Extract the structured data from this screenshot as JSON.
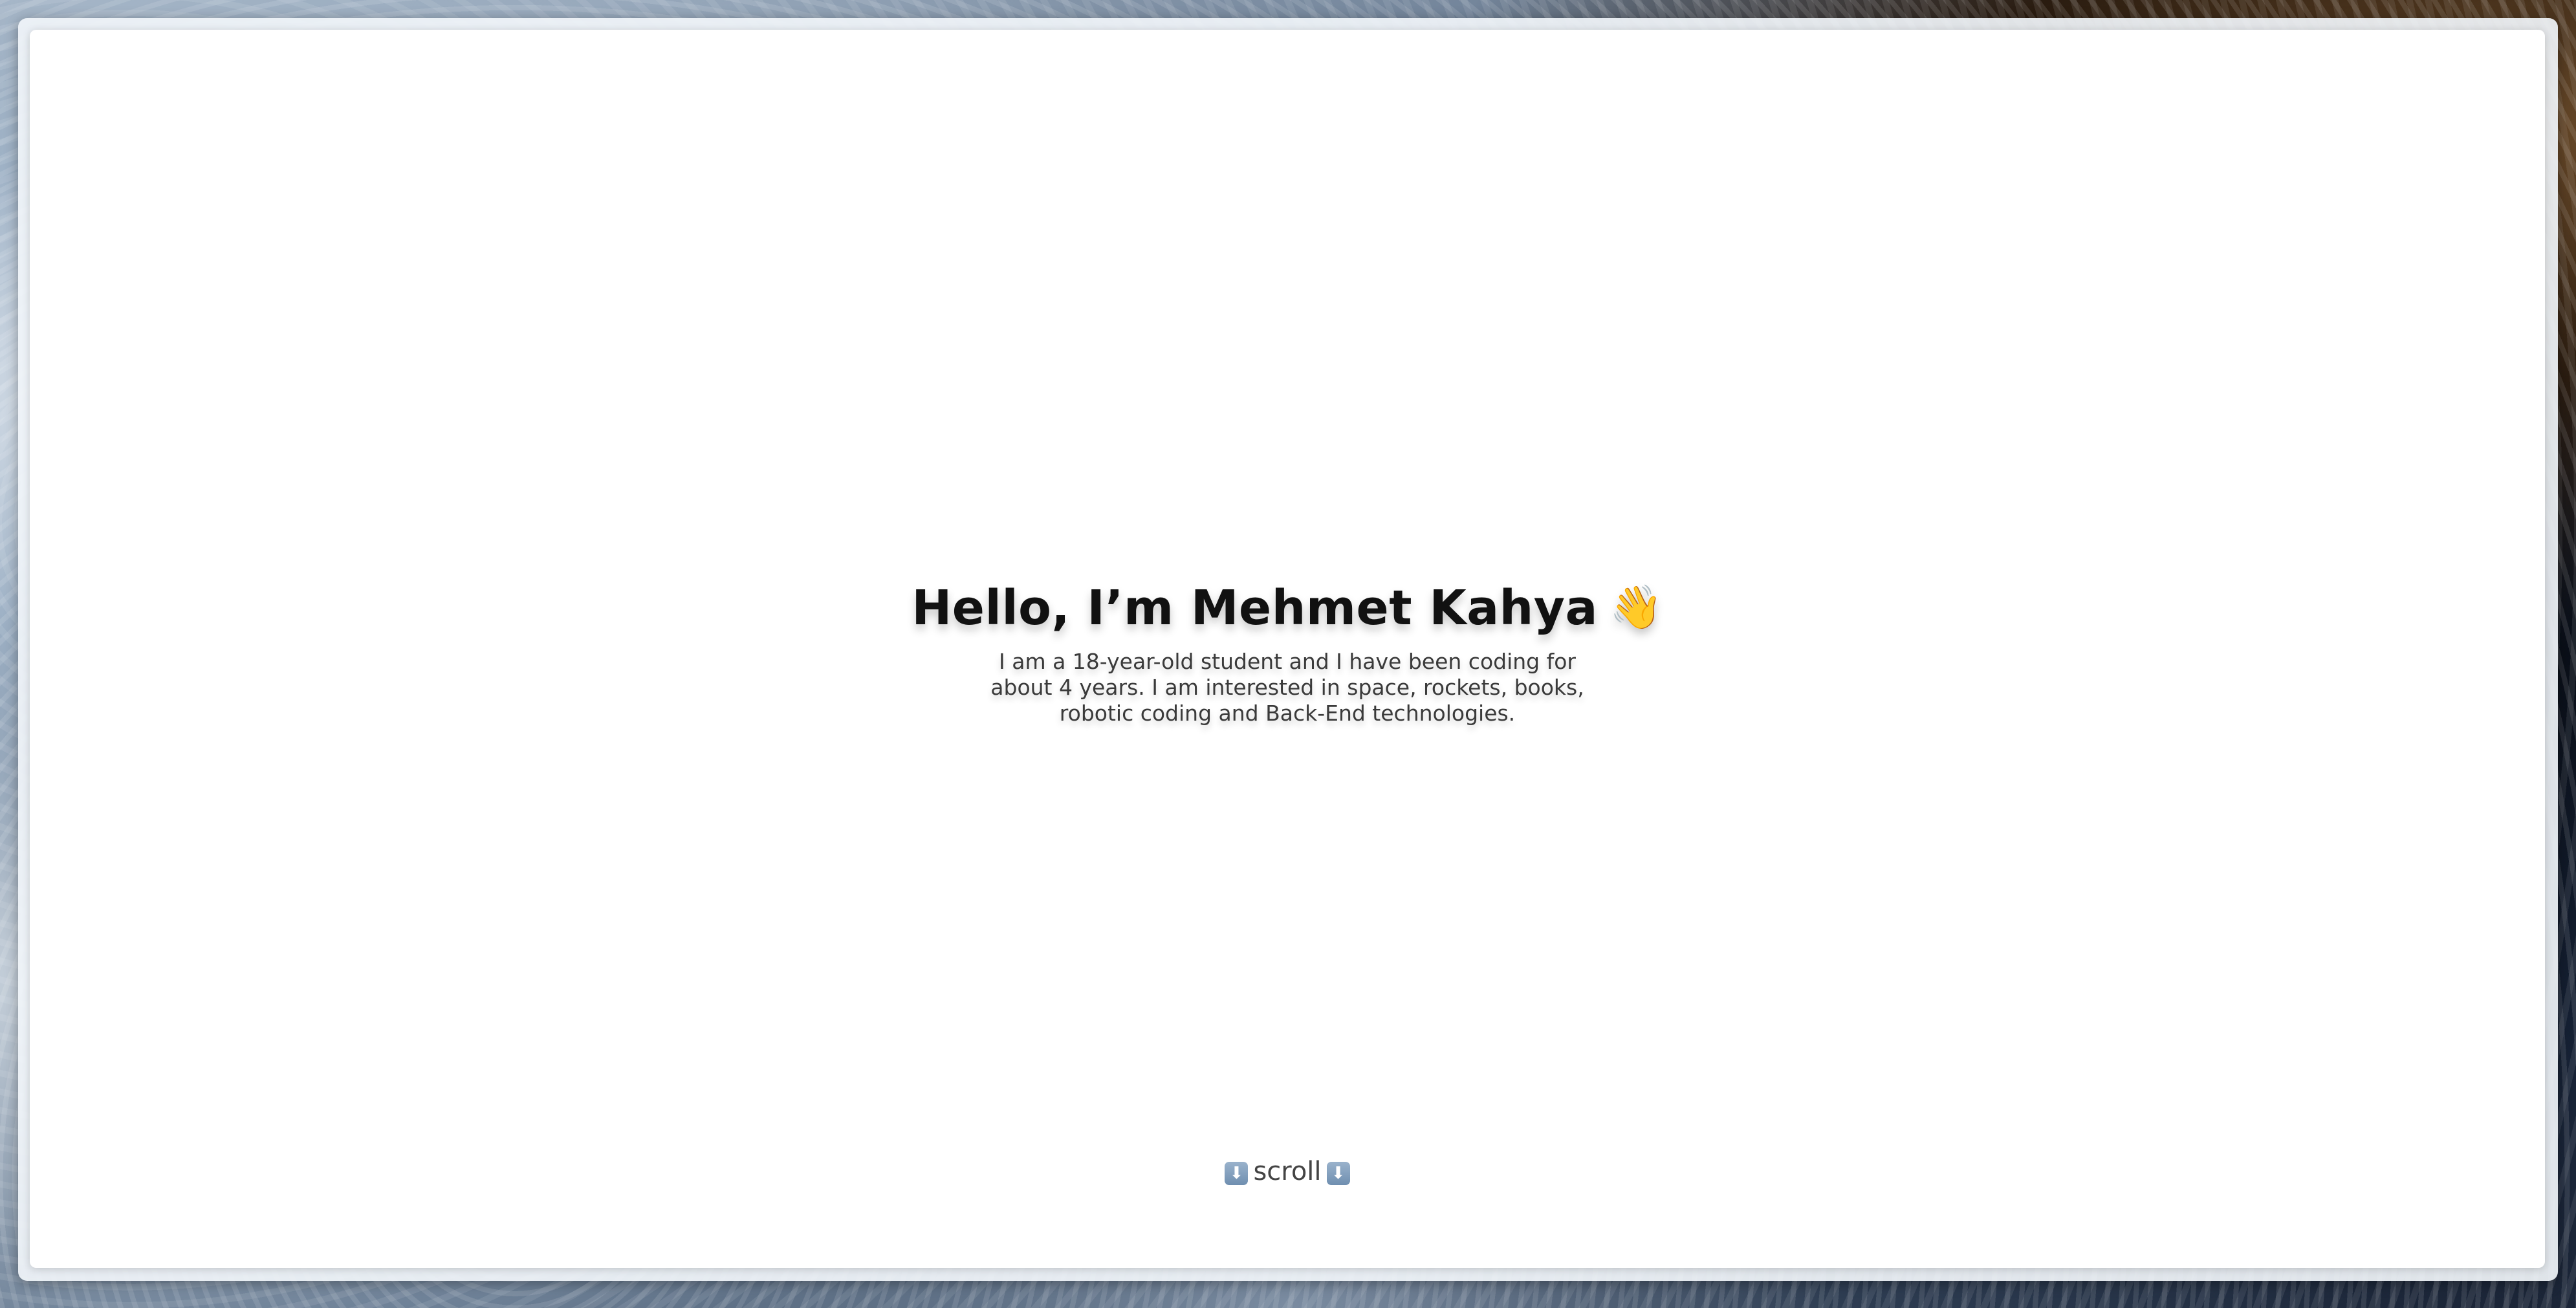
{
  "hero": {
    "title": "Hello, I’m Mehmet Kahya",
    "title_emoji": "👋",
    "description": "I am a 18-year-old student and I have been coding for about 4 years. I am interested in space, rockets, books, robotic coding and Back-End technologies."
  },
  "scroll": {
    "label": "scroll",
    "left_icon": "⬇",
    "right_icon": "⬇"
  }
}
